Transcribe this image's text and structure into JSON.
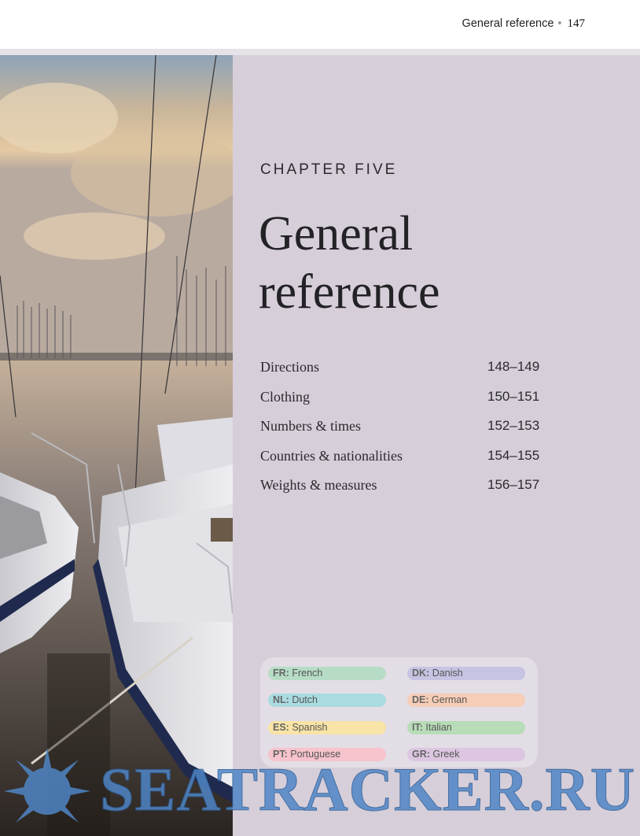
{
  "running_head": {
    "title": "General reference",
    "separator": "•",
    "page": "147"
  },
  "chapter": {
    "label": "CHAPTER FIVE",
    "title_line1": "General",
    "title_line2": "reference"
  },
  "contents": [
    {
      "label": "Directions",
      "pages": "148–149"
    },
    {
      "label": "Clothing",
      "pages": "150–151"
    },
    {
      "label": "Numbers & times",
      "pages": "152–153"
    },
    {
      "label": "Countries & nationalities",
      "pages": "154–155"
    },
    {
      "label": "Weights & measures",
      "pages": "156–157"
    }
  ],
  "languages": [
    {
      "code": "FR:",
      "name": "French",
      "color": "#b6dcc6"
    },
    {
      "code": "DK:",
      "name": "Danish",
      "color": "#c6c3e3"
    },
    {
      "code": "NL:",
      "name": "Dutch",
      "color": "#a9dbe0"
    },
    {
      "code": "DE:",
      "name": "German",
      "color": "#f6cdb7"
    },
    {
      "code": "ES:",
      "name": "Spanish",
      "color": "#f8e4a6"
    },
    {
      "code": "IT:",
      "name": "Italian",
      "color": "#b8dcb8"
    },
    {
      "code": "PT:",
      "name": "Portuguese",
      "color": "#f7c3cc"
    },
    {
      "code": "GR:",
      "name": "Greek",
      "color": "#dcc6e0"
    }
  ],
  "watermark": "SEATRACKER.RU",
  "colors": {
    "panel": "#d6ced9",
    "watermark": "#4f86c6"
  }
}
